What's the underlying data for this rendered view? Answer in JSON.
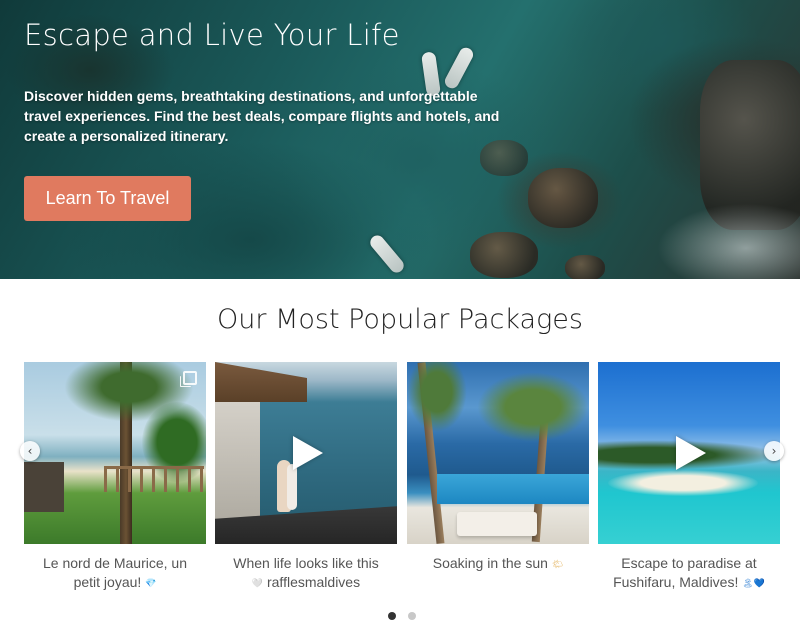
{
  "hero": {
    "title": "Escape and Live Your Life",
    "description": "Discover hidden gems, breathtaking destinations, and unforgettable travel experiences. Find the best deals, compare flights and hotels, and create a personalized itinerary.",
    "cta_label": "Learn To Travel",
    "cta_color": "#e07a5f"
  },
  "packages": {
    "title": "Our Most Popular Packages",
    "cards": [
      {
        "caption": "Le nord de Maurice, un petit joyau!",
        "emoji": "💎",
        "media": "gallery-icon"
      },
      {
        "caption": "When life looks like this",
        "caption2": "rafflesmaldives",
        "emoji": "🤍",
        "media": "play-icon"
      },
      {
        "caption": "Soaking in the sun",
        "emoji": "🌤",
        "media": ""
      },
      {
        "caption": "Escape to paradise at Fushifaru, Maldives!",
        "emoji": "🏝💙",
        "media": "play-icon"
      }
    ],
    "prev_icon": "chevron-left-icon",
    "next_icon": "chevron-right-icon",
    "pagination": {
      "pages": 2,
      "active": 1
    }
  }
}
